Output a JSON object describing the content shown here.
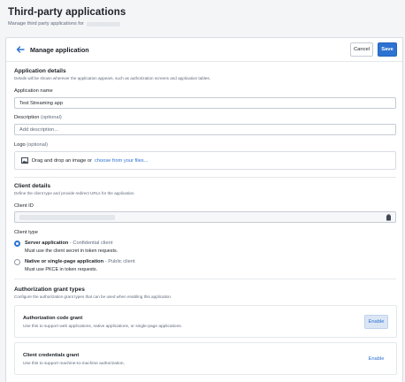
{
  "page": {
    "title": "Third-party applications",
    "subtitle": "Manage third party applications for"
  },
  "header": {
    "title": "Manage application",
    "cancel_label": "Cancel",
    "save_label": "Save"
  },
  "app_details": {
    "title": "Application details",
    "description": "Details will be shown wherever the application appears, such as authorization screens and application tables.",
    "name_label": "Application name",
    "name_value": "Test Streaming app",
    "desc_label": "Description",
    "desc_optional": "(optional)",
    "desc_placeholder": "Add description...",
    "logo_label": "Logo",
    "logo_optional": "(optional)",
    "logo_drop_text": "Drag and drop an image or",
    "logo_link": "choose from your files..."
  },
  "client_details": {
    "title": "Client details",
    "description": "Define the client type and provide redirect URLs for the application.",
    "client_id_label": "Client ID",
    "client_type_label": "Client type",
    "options": [
      {
        "title": "Server application",
        "subtitle": "- Confidential client",
        "desc": "Must use the client secret in token requests.",
        "selected": true
      },
      {
        "title": "Native or single-page application",
        "subtitle": "- Public client",
        "desc": "Must use PKCE in token requests.",
        "selected": false
      }
    ]
  },
  "grants": {
    "title": "Authorization grant types",
    "description": "Configure the authorization grant types that can be used when enabling this application.",
    "items": [
      {
        "title": "Authorization code grant",
        "desc": "Use this to support web applications, native applications, or single-page applications.",
        "action": "Enable"
      },
      {
        "title": "Client credentials grant",
        "desc": "Use this to support machine-to-machine authorization.",
        "action": "Enable"
      }
    ]
  },
  "colors": {
    "accent": "#2d72d2",
    "background": "#f4f5f7",
    "border": "#d8dde3"
  }
}
